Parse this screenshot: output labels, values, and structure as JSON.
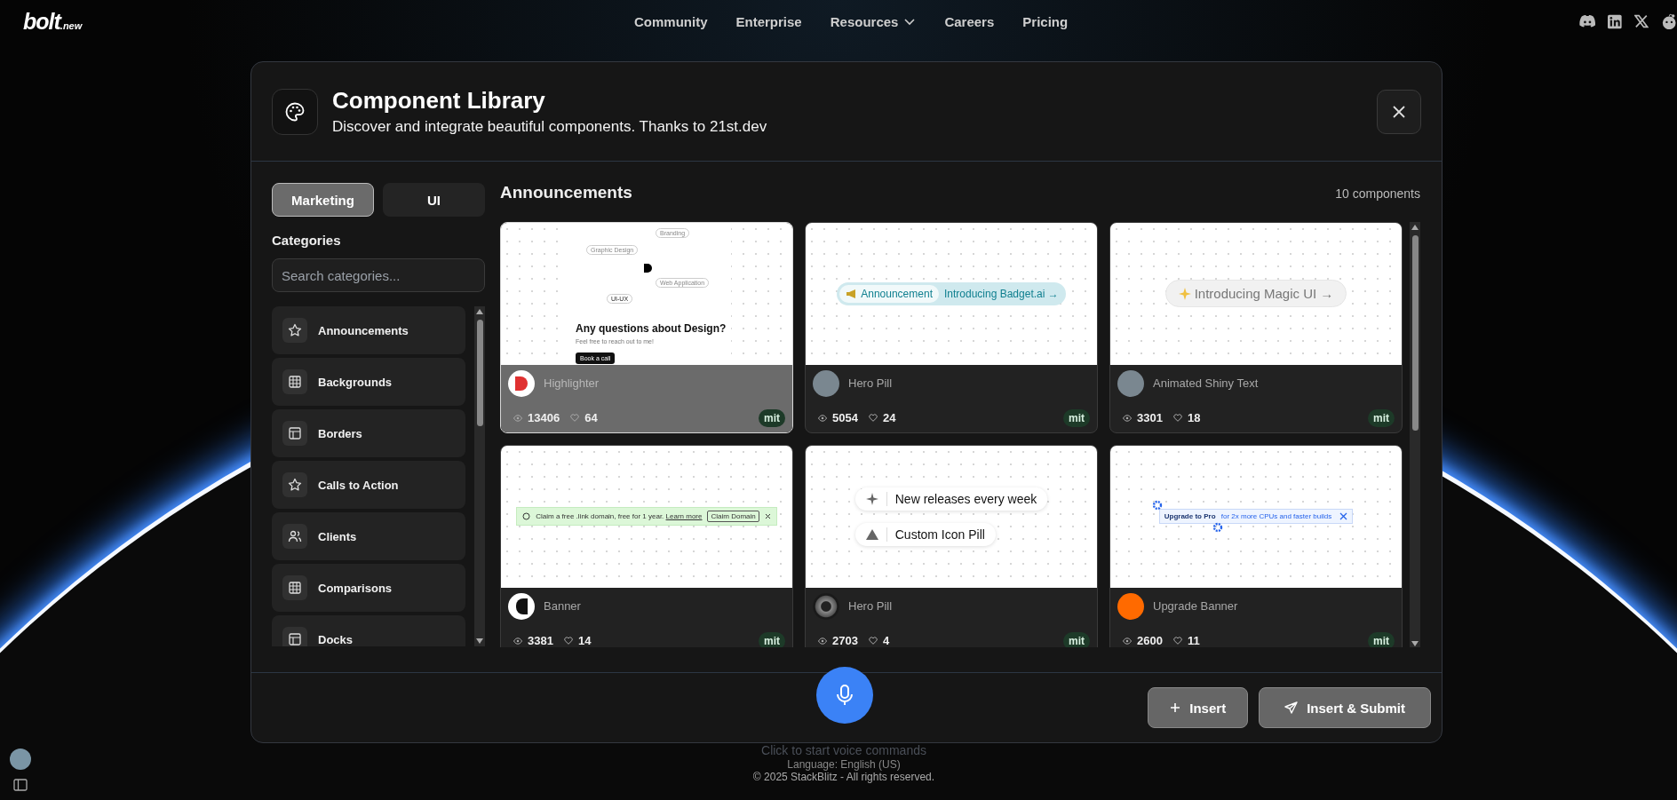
{
  "nav": {
    "logo": "bolt",
    "logo_suffix": ".new",
    "links": [
      {
        "label": "Community",
        "dropdown": false
      },
      {
        "label": "Enterprise",
        "dropdown": false
      },
      {
        "label": "Resources",
        "dropdown": true
      },
      {
        "label": "Careers",
        "dropdown": false
      },
      {
        "label": "Pricing",
        "dropdown": false
      }
    ]
  },
  "dialog": {
    "title": "Component Library",
    "subtitle": "Discover and integrate beautiful components. Thanks to 21st.dev",
    "tabs": [
      {
        "label": "Marketing",
        "selected": true
      },
      {
        "label": "UI",
        "selected": false
      }
    ],
    "categories_label": "Categories",
    "search": {
      "placeholder": "Search categories..."
    },
    "categories": [
      {
        "label": "Announcements",
        "kind": "star"
      },
      {
        "label": "Backgrounds",
        "kind": "grid"
      },
      {
        "label": "Borders",
        "kind": "layout"
      },
      {
        "label": "Calls to Action",
        "kind": "star"
      },
      {
        "label": "Clients",
        "kind": "users"
      },
      {
        "label": "Comparisons",
        "kind": "grid"
      },
      {
        "label": "Docks",
        "kind": "layout"
      }
    ],
    "section_title": "Announcements",
    "count": "10 components",
    "cards": [
      {
        "name": "Highlighter",
        "views": "13406",
        "likes": "64",
        "license": "mit",
        "highlighted": true,
        "avatar": {
          "kind": "logo-red"
        },
        "preview": {
          "kind": "highlighter",
          "chips": [
            "Branding",
            "Graphic Design",
            "Web Application",
            "UI-UX"
          ],
          "heading": "Any questions about Design?",
          "text": "Feel free to reach out to me!",
          "button": "Book a call"
        }
      },
      {
        "name": "Hero Pill",
        "views": "5054",
        "likes": "24",
        "license": "mit",
        "highlighted": false,
        "avatar": {
          "kind": "photo"
        },
        "preview": {
          "kind": "badge-pill",
          "badge": "Announcement",
          "text": "Introducing Badget.ai →"
        }
      },
      {
        "name": "Animated Shiny Text",
        "views": "3301",
        "likes": "18",
        "license": "mit",
        "highlighted": false,
        "avatar": {
          "kind": "photo"
        },
        "preview": {
          "kind": "shiny-pill",
          "text": "Introducing Magic UI →"
        }
      },
      {
        "name": "Banner",
        "views": "3381",
        "likes": "14",
        "license": "mit",
        "highlighted": false,
        "avatar": {
          "kind": "logo-dark"
        },
        "preview": {
          "kind": "banner",
          "text": "Claim a free .link domain, free for 1 year.",
          "link": "Learn more",
          "button": "Claim Domain"
        }
      },
      {
        "name": "Hero Pill",
        "views": "2703",
        "likes": "4",
        "license": "mit",
        "highlighted": false,
        "avatar": {
          "kind": "ring"
        },
        "preview": {
          "kind": "icon-pills",
          "pills": [
            "New releases every week",
            "Custom Icon Pill"
          ]
        }
      },
      {
        "name": "Upgrade Banner",
        "views": "2600",
        "likes": "11",
        "license": "mit",
        "highlighted": false,
        "avatar": {
          "kind": "orange"
        },
        "preview": {
          "kind": "upgrade",
          "title": "Upgrade to Pro",
          "text": "for 2x more CPUs and faster builds"
        }
      }
    ],
    "buttons": [
      {
        "label": "Insert",
        "kind": "insert"
      },
      {
        "label": "Insert & Submit",
        "kind": "submit"
      }
    ]
  },
  "voice_hint": "Click to start voice commands",
  "language": "Language: English (US)",
  "copyright": "© 2025 StackBlitz - All rights reserved."
}
